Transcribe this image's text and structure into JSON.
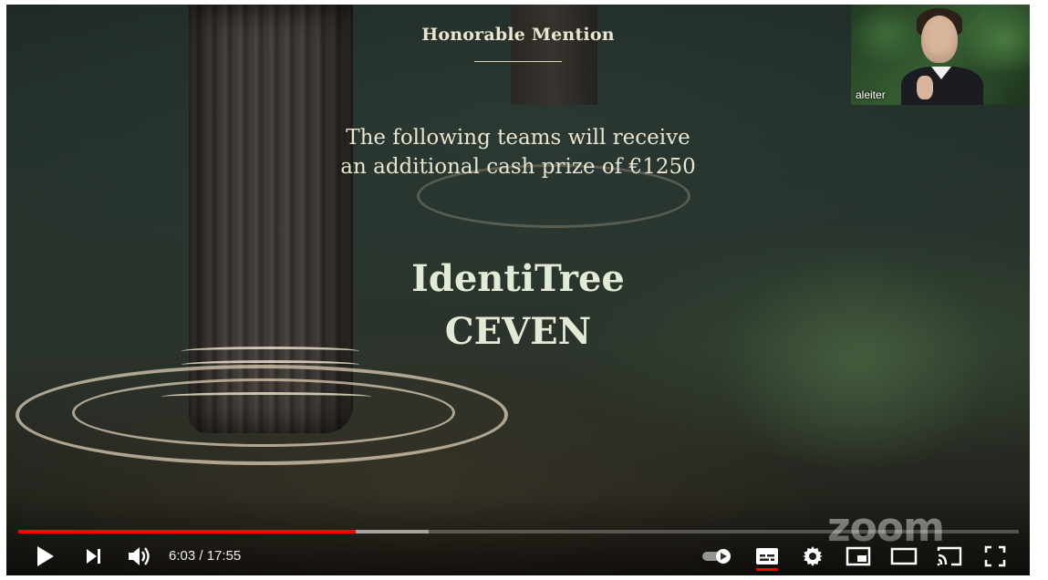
{
  "slide": {
    "heading": "Honorable Mention",
    "subtitle_line1": "The following teams will receive",
    "subtitle_line2": "an additional cash prize of €1250",
    "teams": [
      "IdentiTree",
      "CEVEN"
    ]
  },
  "webcam": {
    "participant_name": "aleiter"
  },
  "watermark": "zoom",
  "player": {
    "current_time": "6:03",
    "separator": " / ",
    "duration": "17:55",
    "played_fraction": 0.337,
    "buffered_fraction": 0.41,
    "accent_color": "#ff0000",
    "icons": [
      "play-icon",
      "next-icon",
      "volume-icon",
      "autoplay-toggle-icon",
      "subtitles-icon",
      "settings-gear-icon",
      "miniplayer-icon",
      "theater-mode-icon",
      "cast-icon",
      "fullscreen-icon"
    ]
  }
}
